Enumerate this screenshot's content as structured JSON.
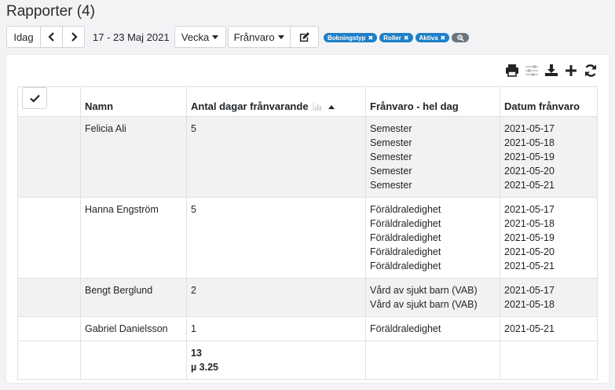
{
  "header": {
    "title": "Rapporter (4)"
  },
  "toolbar": {
    "today_label": "Idag",
    "date_range": "17 - 23 Maj 2021",
    "view_label": "Vecka",
    "report_label": "Frånvaro"
  },
  "filter_tags": [
    {
      "label": "Bokningstyp"
    },
    {
      "label": "Roller"
    },
    {
      "label": "Aktiva"
    }
  ],
  "table": {
    "columns": {
      "name": "Namn",
      "days": "Antal dagar frånvarande",
      "absence": "Frånvaro - hel dag",
      "date": "Datum frånvaro"
    },
    "rows": [
      {
        "name": "Felicia Ali",
        "days": "5",
        "absences": [
          "Semester",
          "Semester",
          "Semester",
          "Semester",
          "Semester"
        ],
        "dates": [
          "2021-05-17",
          "2021-05-18",
          "2021-05-19",
          "2021-05-20",
          "2021-05-21"
        ]
      },
      {
        "name": "Hanna Engström",
        "days": "5",
        "absences": [
          "Föräldraledighet",
          "Föräldraledighet",
          "Föräldraledighet",
          "Föräldraledighet",
          "Föräldraledighet"
        ],
        "dates": [
          "2021-05-17",
          "2021-05-18",
          "2021-05-19",
          "2021-05-20",
          "2021-05-21"
        ]
      },
      {
        "name": "Bengt Berglund",
        "days": "2",
        "absences": [
          "Vård av sjukt barn (VAB)",
          "Vård av sjukt barn (VAB)"
        ],
        "dates": [
          "2021-05-17",
          "2021-05-18"
        ]
      },
      {
        "name": "Gabriel Danielsson",
        "days": "1",
        "absences": [
          "Föräldraledighet"
        ],
        "dates": [
          "2021-05-21"
        ]
      }
    ],
    "summary": {
      "total": "13",
      "mean": "µ 3.25"
    }
  },
  "colors": {
    "accent": "#1f7fc8",
    "row_alt": "#f2f2f2"
  }
}
